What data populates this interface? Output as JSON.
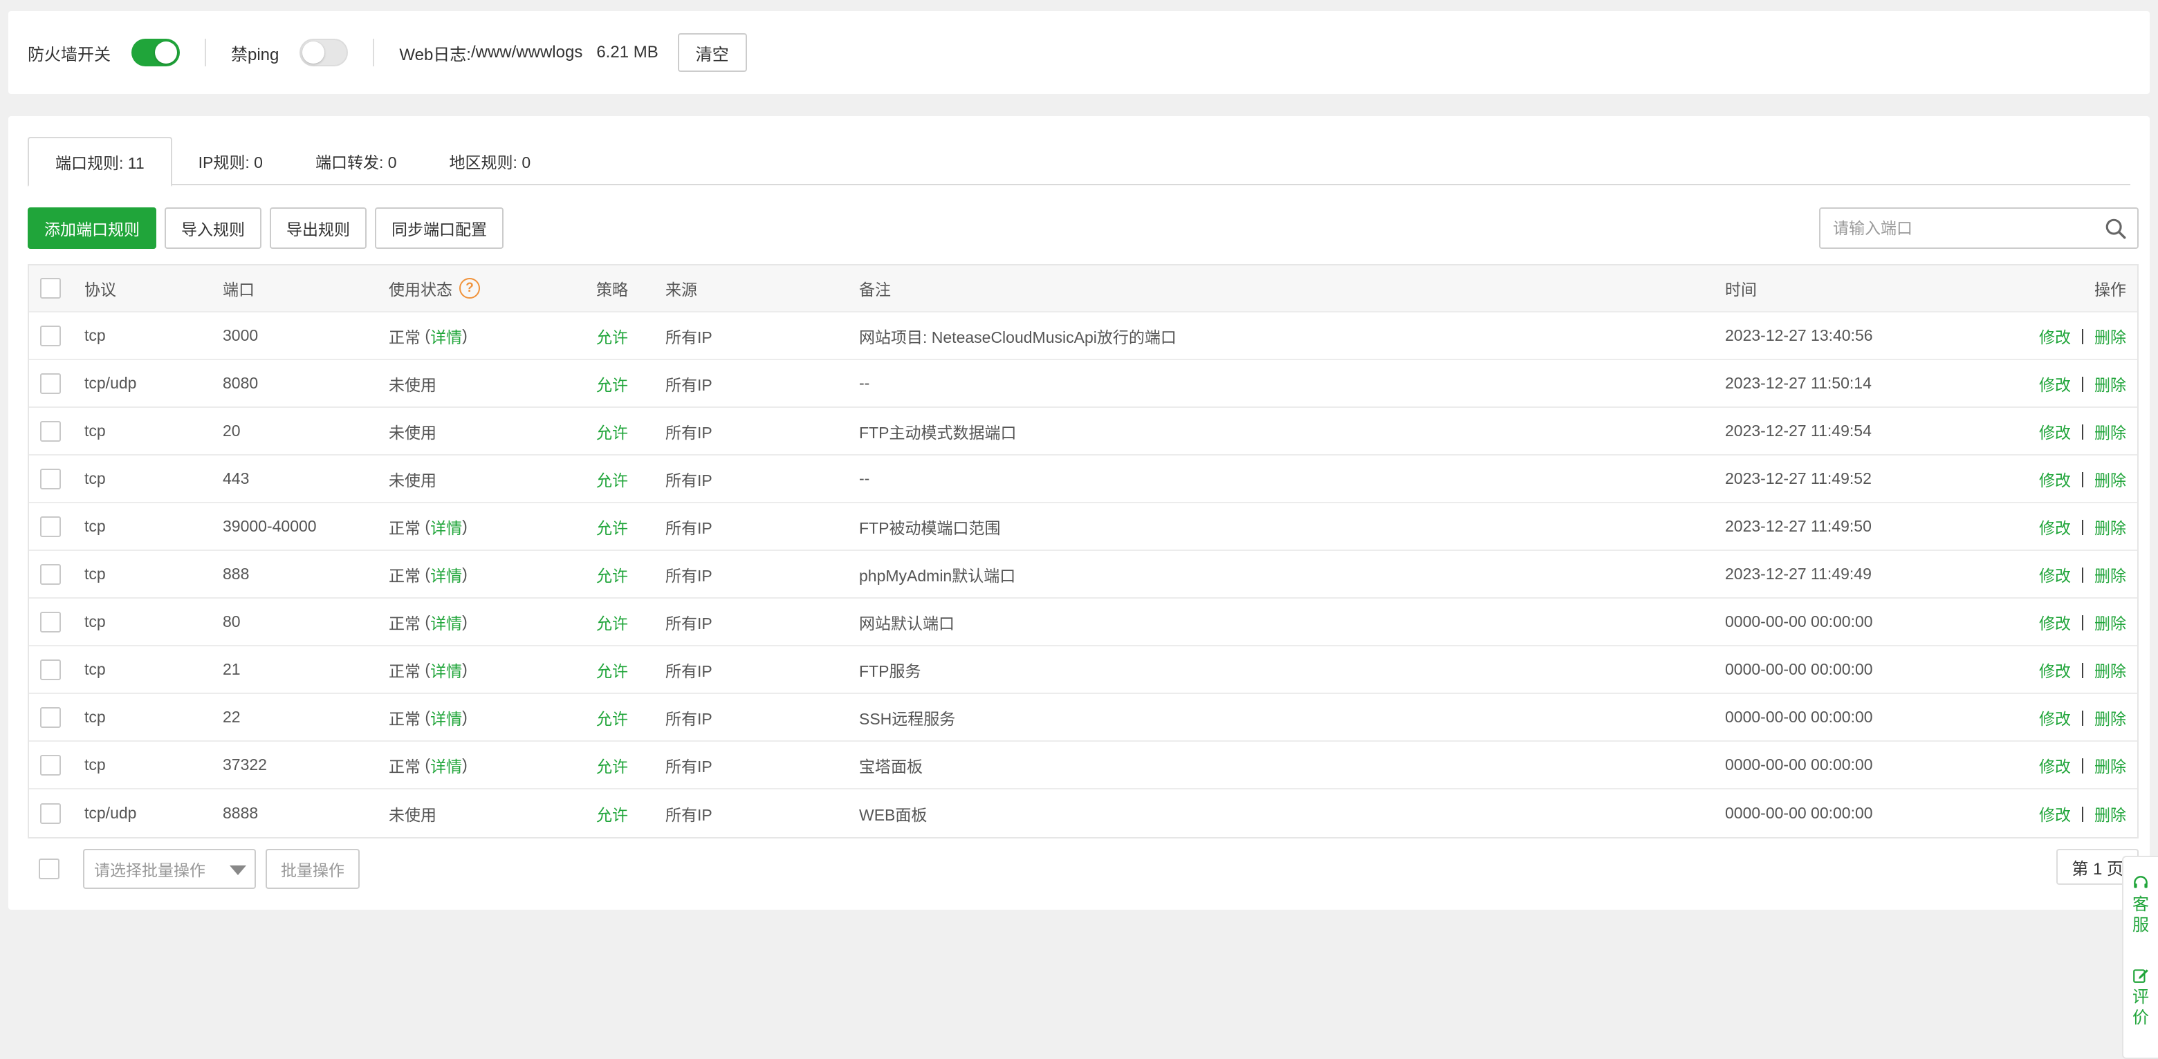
{
  "topbar": {
    "firewall_label": "防火墙开关",
    "firewall_on": true,
    "ping_label": "禁ping",
    "ping_on": false,
    "weblog_label": "Web日志:",
    "weblog_path": "/www/wwwlogs",
    "weblog_size": "6.21 MB",
    "clear_label": "清空"
  },
  "tabs": [
    {
      "label": "端口规则: 11",
      "active": true
    },
    {
      "label": "IP规则: 0",
      "active": false
    },
    {
      "label": "端口转发: 0",
      "active": false
    },
    {
      "label": "地区规则: 0",
      "active": false
    }
  ],
  "toolbar": {
    "add_label": "添加端口规则",
    "import_label": "导入规则",
    "export_label": "导出规则",
    "sync_label": "同步端口配置",
    "search_placeholder": "请输入端口"
  },
  "table": {
    "headers": {
      "protocol": "协议",
      "port": "端口",
      "status": "使用状态",
      "status_help": "?",
      "policy": "策略",
      "source": "来源",
      "note": "备注",
      "time": "时间",
      "ops": "操作"
    },
    "rows": [
      {
        "protocol": "tcp",
        "port": "3000",
        "status": "正常",
        "detail": "详情",
        "policy": "允许",
        "source": "所有IP",
        "note": "网站项目: NeteaseCloudMusicApi放行的端口",
        "time": "2023-12-27 13:40:56"
      },
      {
        "protocol": "tcp/udp",
        "port": "8080",
        "status": "未使用",
        "detail": "",
        "policy": "允许",
        "source": "所有IP",
        "note": "--",
        "time": "2023-12-27 11:50:14"
      },
      {
        "protocol": "tcp",
        "port": "20",
        "status": "未使用",
        "detail": "",
        "policy": "允许",
        "source": "所有IP",
        "note": "FTP主动模式数据端口",
        "time": "2023-12-27 11:49:54"
      },
      {
        "protocol": "tcp",
        "port": "443",
        "status": "未使用",
        "detail": "",
        "policy": "允许",
        "source": "所有IP",
        "note": "--",
        "time": "2023-12-27 11:49:52"
      },
      {
        "protocol": "tcp",
        "port": "39000-40000",
        "status": "正常",
        "detail": "详情",
        "policy": "允许",
        "source": "所有IP",
        "note": "FTP被动模端口范围",
        "time": "2023-12-27 11:49:50"
      },
      {
        "protocol": "tcp",
        "port": "888",
        "status": "正常",
        "detail": "详情",
        "policy": "允许",
        "source": "所有IP",
        "note": "phpMyAdmin默认端口",
        "time": "2023-12-27 11:49:49"
      },
      {
        "protocol": "tcp",
        "port": "80",
        "status": "正常",
        "detail": "详情",
        "policy": "允许",
        "source": "所有IP",
        "note": "网站默认端口",
        "time": "0000-00-00 00:00:00"
      },
      {
        "protocol": "tcp",
        "port": "21",
        "status": "正常",
        "detail": "详情",
        "policy": "允许",
        "source": "所有IP",
        "note": "FTP服务",
        "time": "0000-00-00 00:00:00"
      },
      {
        "protocol": "tcp",
        "port": "22",
        "status": "正常",
        "detail": "详情",
        "policy": "允许",
        "source": "所有IP",
        "note": "SSH远程服务",
        "time": "0000-00-00 00:00:00"
      },
      {
        "protocol": "tcp",
        "port": "37322",
        "status": "正常",
        "detail": "详情",
        "policy": "允许",
        "source": "所有IP",
        "note": "宝塔面板",
        "time": "0000-00-00 00:00:00"
      },
      {
        "protocol": "tcp/udp",
        "port": "8888",
        "status": "未使用",
        "detail": "",
        "policy": "允许",
        "source": "所有IP",
        "note": "WEB面板",
        "time": "0000-00-00 00:00:00"
      }
    ],
    "edit_label": "修改",
    "delete_label": "删除",
    "op_separator": "|"
  },
  "footer": {
    "batch_placeholder": "请选择批量操作",
    "batch_button": "批量操作",
    "page_label": "第 1 页"
  },
  "side": {
    "service_label": "客服",
    "rate_label": "评价"
  },
  "colors": {
    "brand": "#20a53a",
    "help": "#f0923a"
  }
}
